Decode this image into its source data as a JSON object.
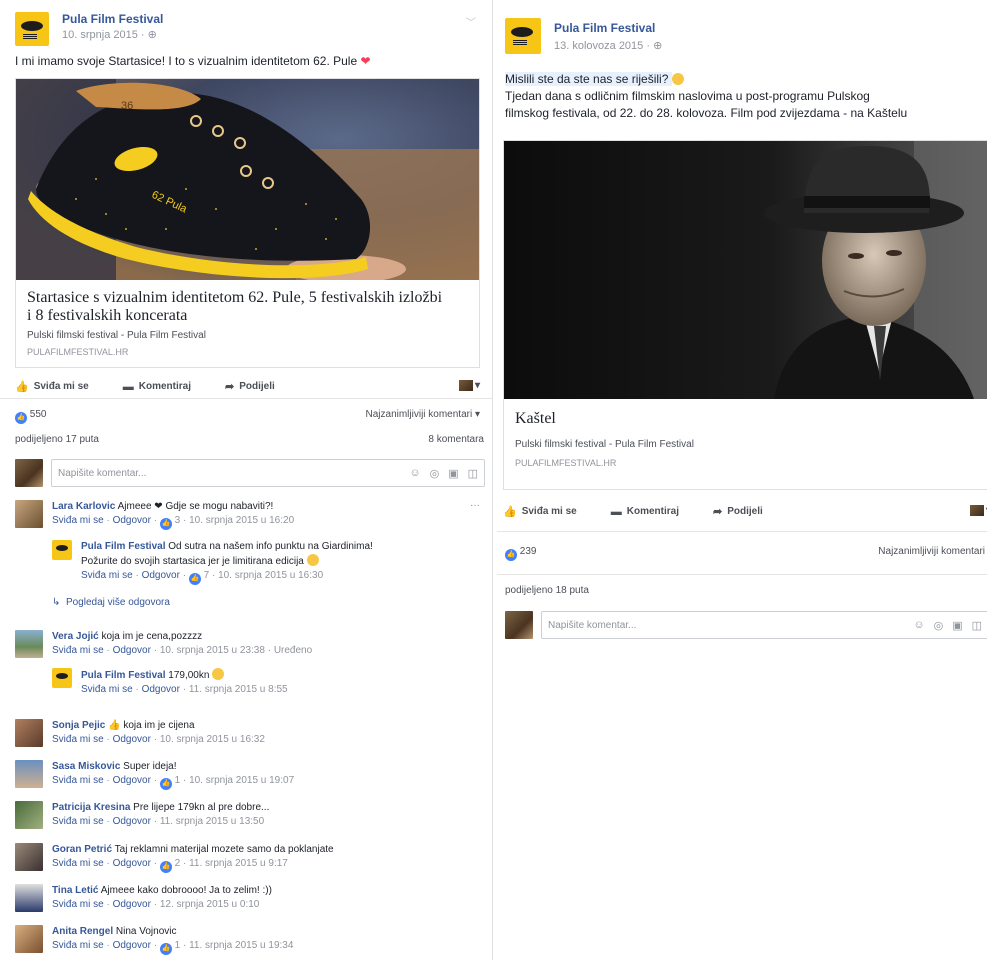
{
  "post1": {
    "page_name": "Pula Film Festival",
    "date": "10. srpnja 2015 · ",
    "audience_icon": "globe-icon",
    "text": "I mi imamo svoje Startasice! I to s vizualnim identitetom 62. Pule ",
    "card": {
      "title": "Startasice s vizualnim identitetom 62. Pule, 5 festivalskih izložbi i 8 festivalskih koncerata",
      "desc": "Pulski filmski festival - Pula Film Festival",
      "domain": "PULAFILMFESTIVAL.HR",
      "shoe_text_1": "62 Pula",
      "shoe_text_2": "36"
    },
    "actions": {
      "like": "Sviđa mi se",
      "comment": "Komentiraj",
      "share": "Podijeli"
    },
    "likes": "550",
    "sort": "Najzanimljiviji komentari ▾",
    "shared": "podijeljeno 17 puta",
    "comment_count": "8 komentara",
    "composer_placeholder": "Napišite komentar...",
    "comments": [
      {
        "name": "Lara Karlovic",
        "text": " Ajmeee ❤ Gdje se mogu nabaviti?!",
        "meta_like": "Sviđa mi se",
        "meta_reply": "Odgovor",
        "count": "3",
        "time": "10. srpnja 2015 u 16:20"
      },
      {
        "name": "Vera Jojić",
        "text": " koja im je cena,pozzzz",
        "meta_like": "Sviđa mi se",
        "meta_reply": "Odgovor",
        "time": "10. srpnja 2015 u 23:38",
        "edited": "Uređeno"
      },
      {
        "name": "Sonja Pejic",
        "text": " koja im je cijena",
        "meta_like": "Sviđa mi se",
        "meta_reply": "Odgovor",
        "time": "10. srpnja 2015 u 16:32"
      },
      {
        "name": "Sasa Miskovic",
        "text": " Super ideja!",
        "meta_like": "Sviđa mi se",
        "meta_reply": "Odgovor",
        "count": "1",
        "time": "10. srpnja 2015 u 19:07"
      },
      {
        "name": "Patricija Kresina",
        "text": " Pre lijepe 179kn al pre dobre...",
        "meta_like": "Sviđa mi se",
        "meta_reply": "Odgovor",
        "time": "11. srpnja 2015 u 13:50"
      },
      {
        "name": "Goran Petrić",
        "text": " Taj reklamni materijal mozete samo da poklanjate",
        "meta_like": "Sviđa mi se",
        "meta_reply": "Odgovor",
        "count": "2",
        "time": "11. srpnja 2015 u 9:17"
      },
      {
        "name": "Tina Letić",
        "text": " Ajmeee kako dobroooo! Ja to zelim! :))",
        "meta_like": "Sviđa mi se",
        "meta_reply": "Odgovor",
        "time": "12. srpnja 2015 u 0:10"
      },
      {
        "name": "Anita Rengel",
        "text": " Nina Vojnovic",
        "meta_like": "Sviđa mi se",
        "meta_reply": "Odgovor",
        "count": "1",
        "time": "11. srpnja 2015 u 19:34"
      }
    ],
    "replies": [
      {
        "name": "Pula Film Festival",
        "text_1": " Od sutra na našem info punktu na Giardinima!",
        "text_2": "Požurite do svojih startasica jer je limitirana edicija ",
        "meta_like": "Sviđa mi se",
        "meta_reply": "Odgovor",
        "count": "7",
        "time": "10. srpnja 2015 u 16:30"
      },
      {
        "name": "Pula Film Festival",
        "text": " 179,00kn ",
        "meta_like": "Sviđa mi se",
        "meta_reply": "Odgovor",
        "time": "11. srpnja 2015 u 8:55"
      }
    ],
    "more_replies": "Pogledaj više odgovora"
  },
  "post2": {
    "page_name": "Pula Film Festival",
    "date": "13. kolovoza 2015 · ",
    "audience_icon": "globe-icon",
    "text_1": "Mislili ste da ste nas se riješili? ",
    "text_2": "Tjedan dana s odličnim filmskim naslovima u post-programu Pulskog",
    "text_3": "filmskog festivala, od 22. do 28. kolovoza. Film pod zvijezdama - na Kaštelu",
    "card": {
      "title": "Kaštel",
      "desc": "Pulski filmski festival - Pula Film Festival",
      "domain": "PULAFILMFESTIVAL.HR"
    },
    "actions": {
      "like": "Sviđa mi se",
      "comment": "Komentiraj",
      "share": "Podijeli"
    },
    "likes": "239",
    "sort": "Najzanimljiviji komentari",
    "shared": "podijeljeno 18 puta",
    "composer_placeholder": "Napišite komentar..."
  },
  "colors": {
    "link": "#365899",
    "like_blue": "#4080ff",
    "brand_yellow": "#f6c515",
    "meta_gray": "#90949c"
  }
}
